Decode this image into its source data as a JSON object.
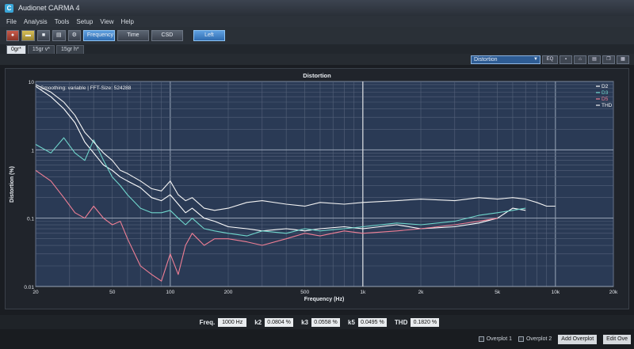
{
  "window": {
    "title": "Audionet CARMA 4",
    "icon": "carma-app-icon"
  },
  "menu": [
    "File",
    "Analysis",
    "Tools",
    "Setup",
    "View",
    "Help"
  ],
  "toolbar": {
    "icons": [
      "record-icon",
      "folder-icon",
      "save-icon",
      "print-icon",
      "settings-icon"
    ],
    "modes": [
      "Frequency",
      "Time",
      "CSD"
    ],
    "channel": "Left"
  },
  "tabs": [
    "0gr*",
    "15gr v*",
    "15gr h*"
  ],
  "view": {
    "selected": "Distortion",
    "eq_label": "EQ"
  },
  "chart_data": {
    "type": "line",
    "title": "Distortion",
    "info": "Smoothing: variable | FFT-Size: 524288",
    "xlabel": "Frequency (Hz)",
    "ylabel": "Distortion (%)",
    "xscale": "log",
    "yscale": "log",
    "xlim": [
      20,
      20000
    ],
    "ylim": [
      0.01,
      10
    ],
    "x_ticks": [
      20,
      50,
      100,
      200,
      500,
      1000,
      2000,
      5000,
      10000,
      20000
    ],
    "x_tick_labels": [
      "20",
      "50",
      "100",
      "200",
      "500",
      "1k",
      "2k",
      "5k",
      "10k",
      "20k"
    ],
    "y_ticks": [
      0.01,
      0.1,
      1,
      10
    ],
    "y_tick_labels": [
      "0.01",
      "0.1",
      "1",
      "10"
    ],
    "cursor_x": 1000,
    "grid": true,
    "legend_position": "top-right",
    "series": [
      {
        "name": "D2",
        "color": "#ffffff",
        "x": [
          20,
          24,
          28,
          32,
          36,
          40,
          45,
          50,
          55,
          60,
          70,
          80,
          90,
          100,
          110,
          120,
          130,
          150,
          170,
          200,
          250,
          300,
          400,
          500,
          600,
          800,
          1000,
          1500,
          2000,
          3000,
          4000,
          5000,
          6000,
          7000
        ],
        "y": [
          8.5,
          6,
          4,
          2.5,
          1.3,
          0.9,
          0.6,
          0.5,
          0.4,
          0.35,
          0.28,
          0.2,
          0.18,
          0.22,
          0.16,
          0.12,
          0.14,
          0.1,
          0.09,
          0.075,
          0.07,
          0.065,
          0.07,
          0.065,
          0.07,
          0.075,
          0.07,
          0.08,
          0.07,
          0.075,
          0.085,
          0.1,
          0.14,
          0.13
        ]
      },
      {
        "name": "D3",
        "color": "#6fd6cc",
        "x": [
          20,
          24,
          28,
          32,
          36,
          40,
          45,
          50,
          55,
          60,
          70,
          80,
          90,
          100,
          110,
          120,
          130,
          150,
          170,
          200,
          250,
          300,
          400,
          500,
          600,
          800,
          1000,
          1500,
          2000,
          3000,
          4000,
          5000,
          6000,
          7000
        ],
        "y": [
          1.2,
          0.9,
          1.5,
          0.9,
          0.7,
          1.4,
          0.7,
          0.4,
          0.3,
          0.22,
          0.14,
          0.12,
          0.12,
          0.13,
          0.1,
          0.08,
          0.1,
          0.07,
          0.065,
          0.06,
          0.055,
          0.065,
          0.06,
          0.07,
          0.065,
          0.07,
          0.075,
          0.085,
          0.08,
          0.09,
          0.11,
          0.12,
          0.13,
          0.14
        ]
      },
      {
        "name": "D5",
        "color": "#f07f95",
        "x": [
          20,
          24,
          28,
          32,
          36,
          40,
          45,
          50,
          55,
          60,
          70,
          80,
          90,
          100,
          110,
          120,
          130,
          150,
          170,
          200,
          250,
          300,
          400,
          500,
          600,
          800,
          1000,
          1500,
          2000,
          3000,
          4000,
          5000
        ],
        "y": [
          0.5,
          0.35,
          0.2,
          0.12,
          0.1,
          0.15,
          0.1,
          0.08,
          0.09,
          0.05,
          0.02,
          0.015,
          0.012,
          0.03,
          0.015,
          0.04,
          0.06,
          0.04,
          0.05,
          0.05,
          0.045,
          0.04,
          0.05,
          0.06,
          0.055,
          0.065,
          0.06,
          0.065,
          0.07,
          0.08,
          0.09,
          0.1
        ]
      },
      {
        "name": "THD",
        "color": "#f4f4f4",
        "x": [
          20,
          24,
          28,
          32,
          36,
          40,
          45,
          50,
          55,
          60,
          70,
          80,
          90,
          100,
          110,
          120,
          130,
          150,
          170,
          200,
          250,
          300,
          400,
          500,
          600,
          800,
          1000,
          1500,
          2000,
          3000,
          4000,
          5000,
          6000,
          7000,
          8000,
          9000,
          10000
        ],
        "y": [
          9,
          7,
          5,
          3.2,
          1.8,
          1.3,
          0.9,
          0.7,
          0.5,
          0.45,
          0.35,
          0.27,
          0.25,
          0.35,
          0.22,
          0.18,
          0.2,
          0.14,
          0.13,
          0.14,
          0.17,
          0.18,
          0.16,
          0.15,
          0.17,
          0.16,
          0.17,
          0.18,
          0.19,
          0.18,
          0.2,
          0.19,
          0.2,
          0.19,
          0.17,
          0.15,
          0.15
        ]
      }
    ]
  },
  "status": {
    "freq_label": "Freq.",
    "freq_value": "1000 Hz",
    "k2_label": "k2",
    "k2_value": "0.0804 %",
    "k3_label": "k3",
    "k3_value": "0.0558 %",
    "k5_label": "k5",
    "k5_value": "0.0495 %",
    "thd_label": "THD",
    "thd_value": "0.1820 %"
  },
  "bottom": {
    "overplot1": "Overplot 1",
    "overplot2": "Overplot 2",
    "add_overplot": "Add Overplot",
    "edit_overplot": "Edit Ove"
  }
}
